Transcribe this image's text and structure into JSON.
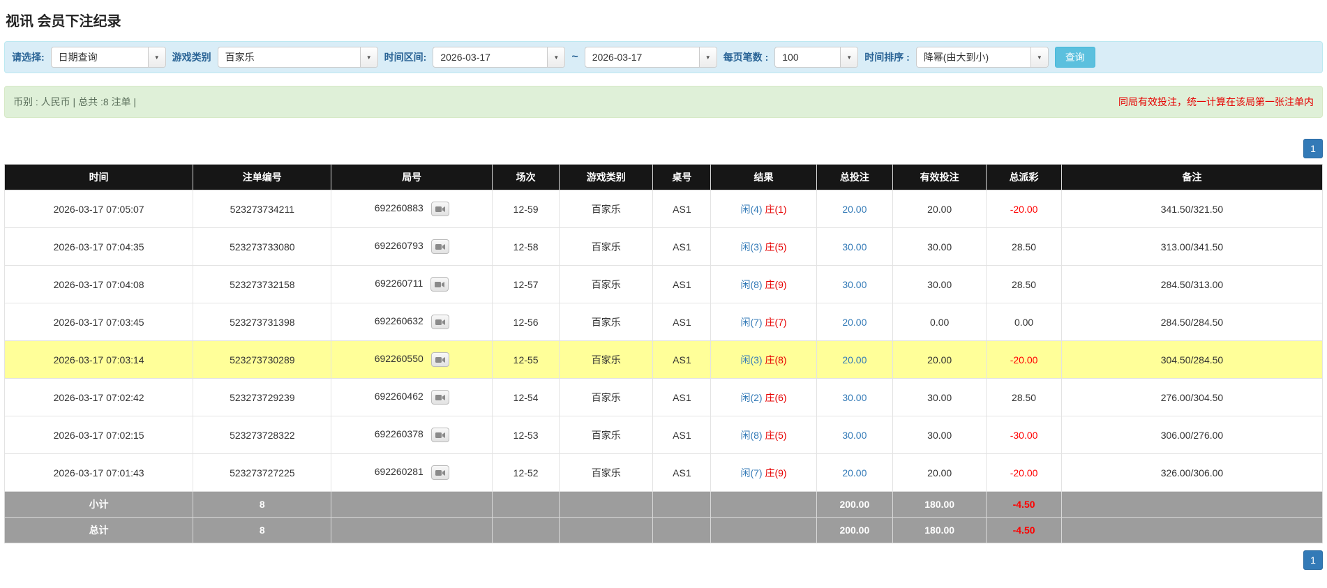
{
  "page": {
    "title": "视讯 会员下注纪录"
  },
  "icons": {
    "caret_down": "▼",
    "video_replay": "svg-video-camera"
  },
  "filters": {
    "select_label": "请选择:",
    "select_value": "日期查询",
    "game_type_label": "游戏类别",
    "game_type_value": "百家乐",
    "time_range_label": "时间区间:",
    "date_from": "2026-03-17",
    "range_separator": "~",
    "date_to": "2026-03-17",
    "page_size_label": "每页笔数 :",
    "page_size_value": "100",
    "sort_label": "时间排序 :",
    "sort_value": "降幂(由大到小)",
    "query_button": "查询"
  },
  "info_bar": {
    "left": "币别 : 人民币 | 总共 :8 注单 |",
    "right": "同局有效投注，统一计算在该局第一张注单内"
  },
  "pagination": {
    "current_page": "1"
  },
  "table": {
    "headers": [
      "时间",
      "注单编号",
      "局号",
      "场次",
      "游戏类别",
      "桌号",
      "结果",
      "总投注",
      "有效投注",
      "总派彩",
      "备注"
    ],
    "rows": [
      {
        "time": "2026-03-17 07:05:07",
        "bet_id": "523273734211",
        "round_id": "692260883",
        "session": "12-59",
        "game_type": "百家乐",
        "table_no": "AS1",
        "result_player": "闲(4)",
        "result_banker": "庄(1)",
        "total_bet": "20.00",
        "valid_bet": "20.00",
        "payout": "-20.00",
        "remark": "341.50/321.50",
        "highlighted": false
      },
      {
        "time": "2026-03-17 07:04:35",
        "bet_id": "523273733080",
        "round_id": "692260793",
        "session": "12-58",
        "game_type": "百家乐",
        "table_no": "AS1",
        "result_player": "闲(3)",
        "result_banker": "庄(5)",
        "total_bet": "30.00",
        "valid_bet": "30.00",
        "payout": "28.50",
        "remark": "313.00/341.50",
        "highlighted": false
      },
      {
        "time": "2026-03-17 07:04:08",
        "bet_id": "523273732158",
        "round_id": "692260711",
        "session": "12-57",
        "game_type": "百家乐",
        "table_no": "AS1",
        "result_player": "闲(8)",
        "result_banker": "庄(9)",
        "total_bet": "30.00",
        "valid_bet": "30.00",
        "payout": "28.50",
        "remark": "284.50/313.00",
        "highlighted": false
      },
      {
        "time": "2026-03-17 07:03:45",
        "bet_id": "523273731398",
        "round_id": "692260632",
        "session": "12-56",
        "game_type": "百家乐",
        "table_no": "AS1",
        "result_player": "闲(7)",
        "result_banker": "庄(7)",
        "total_bet": "20.00",
        "valid_bet": "0.00",
        "payout": "0.00",
        "remark": "284.50/284.50",
        "highlighted": false
      },
      {
        "time": "2026-03-17 07:03:14",
        "bet_id": "523273730289",
        "round_id": "692260550",
        "session": "12-55",
        "game_type": "百家乐",
        "table_no": "AS1",
        "result_player": "闲(3)",
        "result_banker": "庄(8)",
        "total_bet": "20.00",
        "valid_bet": "20.00",
        "payout": "-20.00",
        "remark": "304.50/284.50",
        "highlighted": true
      },
      {
        "time": "2026-03-17 07:02:42",
        "bet_id": "523273729239",
        "round_id": "692260462",
        "session": "12-54",
        "game_type": "百家乐",
        "table_no": "AS1",
        "result_player": "闲(2)",
        "result_banker": "庄(6)",
        "total_bet": "30.00",
        "valid_bet": "30.00",
        "payout": "28.50",
        "remark": "276.00/304.50",
        "highlighted": false
      },
      {
        "time": "2026-03-17 07:02:15",
        "bet_id": "523273728322",
        "round_id": "692260378",
        "session": "12-53",
        "game_type": "百家乐",
        "table_no": "AS1",
        "result_player": "闲(8)",
        "result_banker": "庄(5)",
        "total_bet": "30.00",
        "valid_bet": "30.00",
        "payout": "-30.00",
        "remark": "306.00/276.00",
        "highlighted": false
      },
      {
        "time": "2026-03-17 07:01:43",
        "bet_id": "523273727225",
        "round_id": "692260281",
        "session": "12-52",
        "game_type": "百家乐",
        "table_no": "AS1",
        "result_player": "闲(7)",
        "result_banker": "庄(9)",
        "total_bet": "20.00",
        "valid_bet": "20.00",
        "payout": "-20.00",
        "remark": "326.00/306.00",
        "highlighted": false
      }
    ],
    "subtotal": {
      "label": "小计",
      "count": "8",
      "total_bet": "200.00",
      "valid_bet": "180.00",
      "payout": "-4.50"
    },
    "total": {
      "label": "总计",
      "count": "8",
      "total_bet": "200.00",
      "valid_bet": "180.00",
      "payout": "-4.50"
    }
  }
}
